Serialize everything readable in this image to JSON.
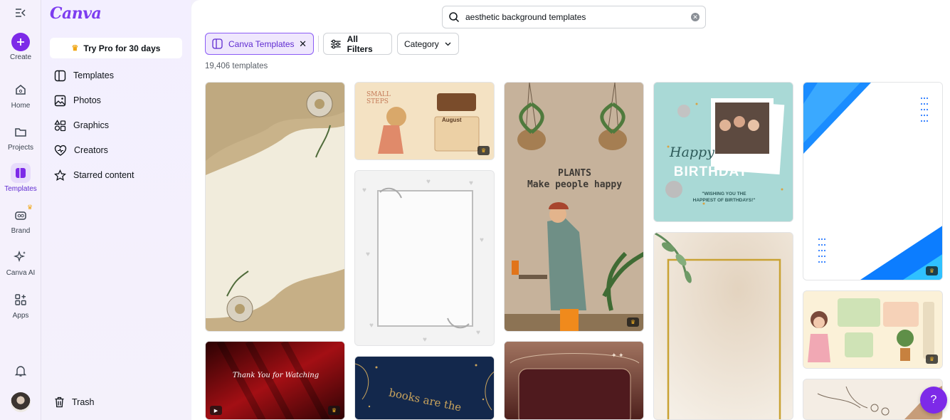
{
  "rail": {
    "create": "Create",
    "home": "Home",
    "projects": "Projects",
    "templates": "Templates",
    "brand": "Brand",
    "canva_ai": "Canva AI",
    "apps": "Apps"
  },
  "panel": {
    "logo": "Canva",
    "pro_button": "Try Pro for 30 days",
    "items": [
      "Templates",
      "Photos",
      "Graphics",
      "Creators",
      "Starred content"
    ],
    "trash": "Trash"
  },
  "search": {
    "query": "aesthetic background templates"
  },
  "filters": {
    "selected_chip": "Canva Templates",
    "all_filters": "All Filters",
    "category": "Category"
  },
  "results": {
    "count": "19,406 templates"
  },
  "templates": {
    "plants_line1": "PLANTS",
    "plants_line2": "Make people happy",
    "birthday_happy": "Happy",
    "birthday_title": "BIRTHDAY",
    "birthday_sub1": "\"WISHING YOU THE",
    "birthday_sub2": "HAPPIEST OF BIRTHDAYS!\"",
    "thanks": "Thank You for Watching",
    "books": "books are the",
    "steps1": "SMALL",
    "steps2": "STEPS",
    "august": "August"
  },
  "help": "?",
  "colors": {
    "accent": "#7d2ae8",
    "selected_chip_bg": "#efe7fd"
  }
}
